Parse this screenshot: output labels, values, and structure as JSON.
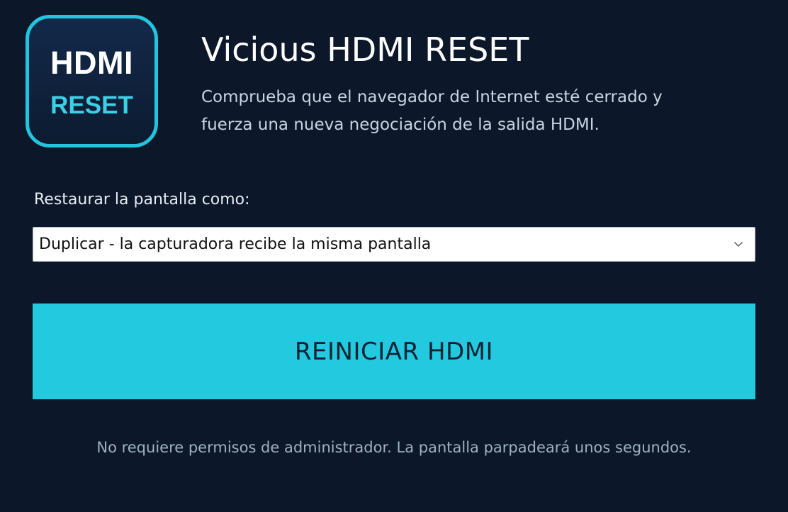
{
  "header": {
    "icon": {
      "name": "hdmi-reset-logo",
      "line1": "HDMI",
      "line2": "RESET"
    },
    "title": "Vicious HDMI RESET",
    "description": "Comprueba que el navegador de Internet esté cerrado y fuerza una nueva negociación de la salida HDMI."
  },
  "display_mode": {
    "label": "Restaurar la pantalla como:",
    "selected": "Duplicar - la capturadora recibe la misma pantalla",
    "dropdown_icon": "chevron-down-icon"
  },
  "action": {
    "button_label": "REINICIAR HDMI"
  },
  "footer": {
    "note": "No requiere permisos de administrador. La pantalla parpadeará unos segundos."
  },
  "colors": {
    "background": "#0c1829",
    "accent": "#22c9df",
    "button_text": "#0b2233",
    "muted_text": "#9fb0c4"
  }
}
